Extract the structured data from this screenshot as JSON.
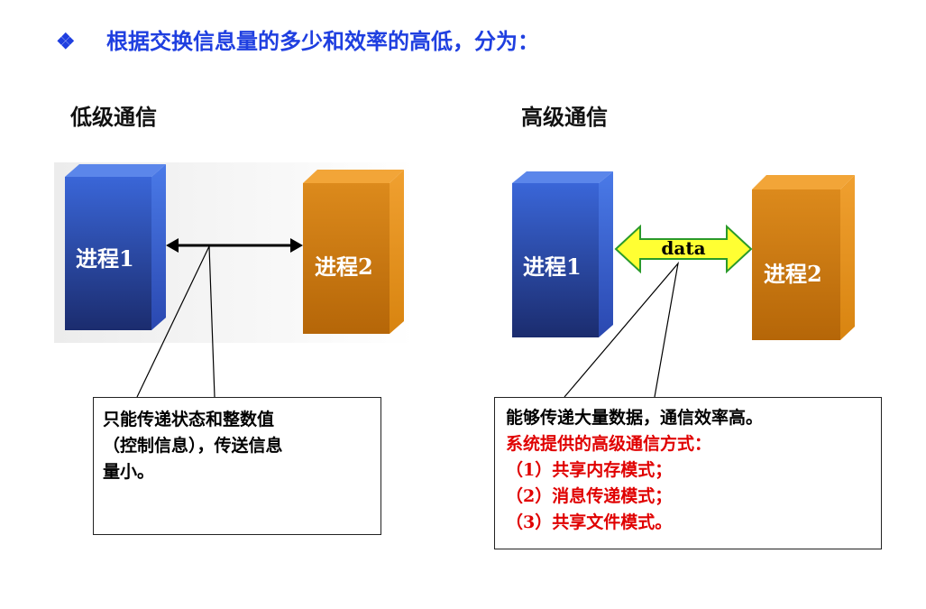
{
  "heading": {
    "text": "根据交换信息量的多少和效率的高低，分为：",
    "bullet": "❖"
  },
  "low": {
    "title": "低级通信",
    "process1": "进程1",
    "process2": "进程2",
    "note": [
      "只能传递状态和整数值",
      "（控制信息），传送信息",
      "量小。"
    ]
  },
  "high": {
    "title": "高级通信",
    "process1": "进程1",
    "process2": "进程2",
    "arrow_label": "data",
    "note_line1": "能够传递大量数据，通信效率高。",
    "note_red": [
      "系统提供的高级通信方式：",
      "（1）共享内存模式；",
      "（2）消息传递模式；",
      "（3）共享文件模式。"
    ]
  },
  "colors": {
    "heading": "#1f3fe0",
    "blue_front": "#2f55c8",
    "orange_front": "#d07a10",
    "arrow_fill": "#ffff33",
    "red_text": "#e00000"
  }
}
